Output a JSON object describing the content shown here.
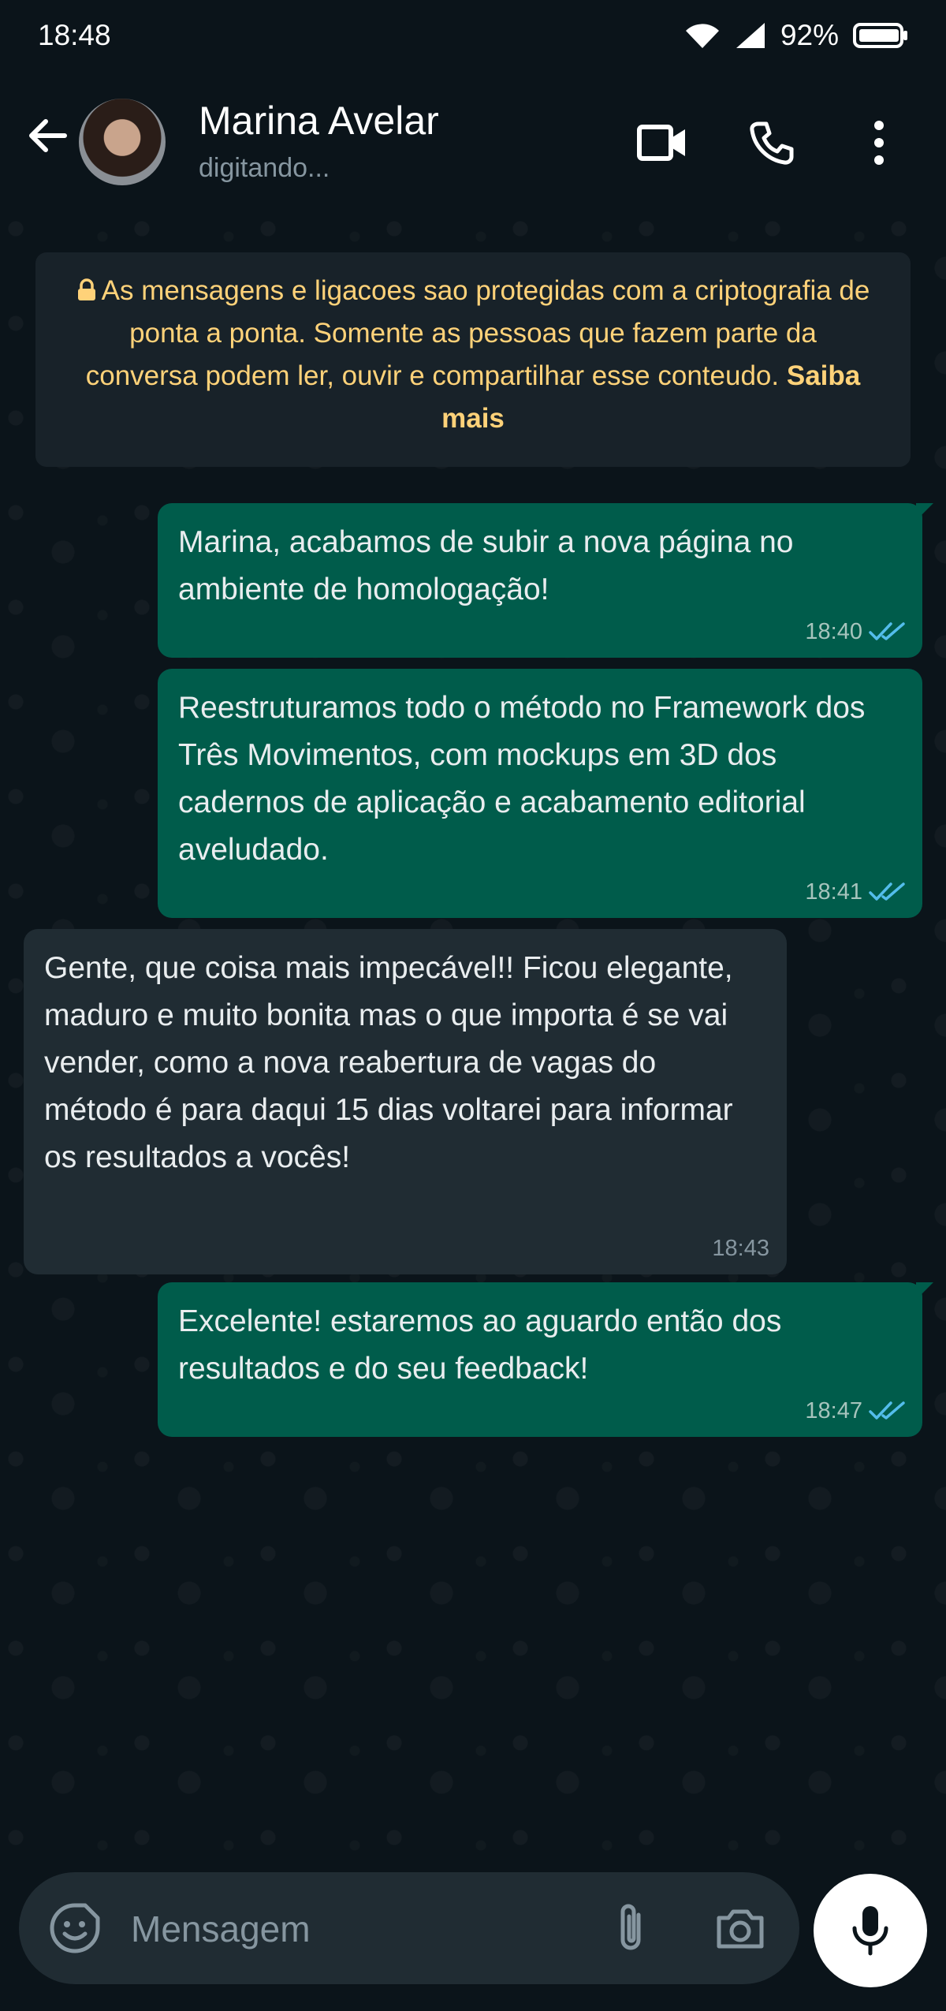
{
  "status_bar": {
    "time": "18:48",
    "battery": "92%",
    "icons": [
      "wifi-icon",
      "signal-icon",
      "battery-icon"
    ]
  },
  "header": {
    "contact_name": "Marina Avelar",
    "contact_status": "digitando...",
    "icons": [
      "back-arrow-icon",
      "video-call-icon",
      "phone-call-icon",
      "more-vert-icon"
    ]
  },
  "encryption_notice": {
    "text": "As mensagens e ligacoes sao protegidas com a criptografia de ponta a ponta. Somente as pessoas que fazem parte da conversa podem ler, ouvir e compartilhar esse conteudo.",
    "link": "Saiba mais"
  },
  "messages": [
    {
      "direction": "out",
      "text": "Marina, acabamos de subir a nova página no ambiente de homologação!",
      "time": "18:40",
      "status": "read"
    },
    {
      "direction": "out",
      "text": "Reestruturamos todo o método no Framework dos Três Movimentos, com mockups em 3D dos cadernos de aplicação e acabamento editorial aveludado.",
      "time": "18:41",
      "status": "read"
    },
    {
      "direction": "in",
      "text": "Gente, que coisa mais impecável!! Ficou elegante, maduro e muito bonita mas o que importa é se vai vender, como a nova reabertura de vagas do método é para daqui 15 dias voltarei para informar os resultados a vocês!",
      "time": "18:43"
    },
    {
      "direction": "out",
      "text": "Excelente! estaremos ao aguardo então dos resultados e do seu feedback!",
      "time": "18:47",
      "status": "read"
    }
  ],
  "composer": {
    "placeholder": "Mensagem",
    "icons": [
      "sticker-icon",
      "attach-icon",
      "camera-icon",
      "mic-icon"
    ]
  },
  "colors": {
    "background": "#0b141a",
    "outgoing_bubble": "#005c4b",
    "incoming_bubble": "#202c33",
    "notice_text": "#ffd279",
    "read_ticks": "#53bdeb"
  }
}
